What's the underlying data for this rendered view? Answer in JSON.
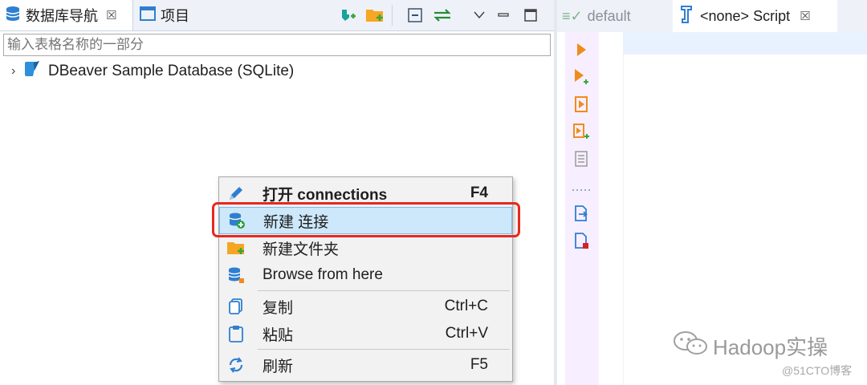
{
  "left_panel": {
    "tabs": [
      {
        "label": "数据库导航",
        "close": "☒"
      },
      {
        "label": "项目"
      }
    ],
    "filter_placeholder": "输入表格名称的一部分",
    "tree": [
      {
        "label": "DBeaver Sample Database (SQLite)",
        "expander": "›"
      }
    ]
  },
  "editor": {
    "tabs": [
      {
        "label": "default",
        "prefix": "≡✓"
      },
      {
        "label": "<none> Script",
        "close": "☒"
      }
    ]
  },
  "context_menu": {
    "items": [
      {
        "label": "打开 connections",
        "shortcut": "F4",
        "icon": "pencil-icon"
      },
      {
        "label": "新建 连接",
        "shortcut": "",
        "icon": "new-connection-icon"
      },
      {
        "label": "新建文件夹",
        "shortcut": "",
        "icon": "new-folder-icon"
      },
      {
        "label": "Browse from here",
        "shortcut": "",
        "icon": "database-browse-icon"
      },
      {
        "label": "复制",
        "shortcut": "Ctrl+C",
        "icon": "copy-icon"
      },
      {
        "label": "粘贴",
        "shortcut": "Ctrl+V",
        "icon": "paste-icon"
      },
      {
        "label": "刷新",
        "shortcut": "F5",
        "icon": "refresh-icon"
      }
    ]
  },
  "watermark": {
    "main": "Hadoop实操",
    "sub": "@51CTO博客"
  },
  "colors": {
    "tab_bar": "#eef2f8",
    "menu_selected": "#cde8fb",
    "highlight_box": "#e8281e",
    "editor_toolbar": "#f7efff",
    "accent_orange": "#f08c1c"
  }
}
